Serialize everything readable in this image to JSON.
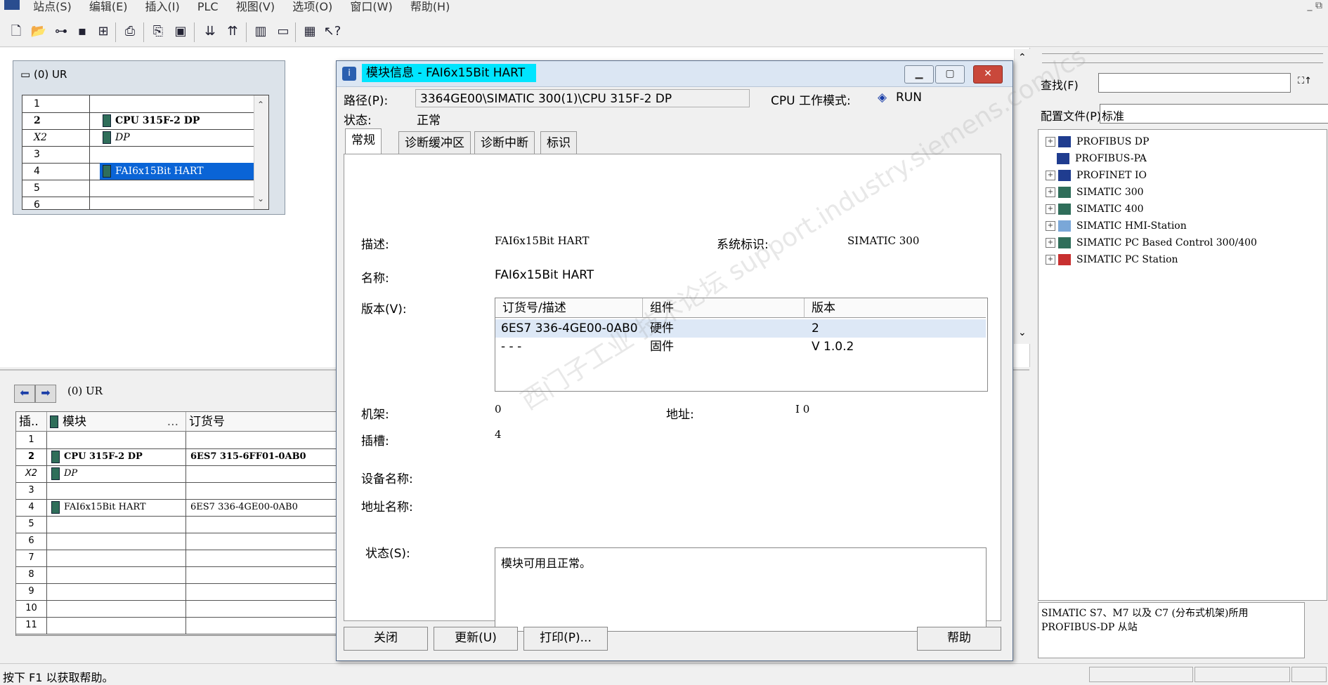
{
  "menu": [
    "站点(S)",
    "编辑(E)",
    "插入(I)",
    "PLC",
    "视图(V)",
    "选项(O)",
    "窗口(W)",
    "帮助(H)"
  ],
  "window_controls": "_ ⧉",
  "rack": {
    "title": "(0) UR",
    "rows": [
      {
        "slot": "1",
        "module": ""
      },
      {
        "slot": "2",
        "module": "CPU 315F-2 DP"
      },
      {
        "slot": "X2",
        "module": "DP"
      },
      {
        "slot": "3",
        "module": ""
      },
      {
        "slot": "4",
        "module": "FAI6x15Bit HART"
      },
      {
        "slot": "5",
        "module": ""
      },
      {
        "slot": "6",
        "module": ""
      }
    ]
  },
  "lower": {
    "title": "(0)    UR",
    "col_slot": "插..",
    "col_module": "模块",
    "col_module_more": "...",
    "col_order": "订货号",
    "rows": [
      {
        "slot": "1",
        "module": "",
        "order": ""
      },
      {
        "slot": "2",
        "module": "CPU 315F-2 DP",
        "order": "6ES7 315-6FF01-0AB0"
      },
      {
        "slot": "X2",
        "module": "DP",
        "order": ""
      },
      {
        "slot": "3",
        "module": "",
        "order": ""
      },
      {
        "slot": "4",
        "module": "FAI6x15Bit HART",
        "order": "6ES7 336-4GE00-0AB0"
      },
      {
        "slot": "5",
        "module": "",
        "order": ""
      },
      {
        "slot": "6",
        "module": "",
        "order": ""
      },
      {
        "slot": "7",
        "module": "",
        "order": ""
      },
      {
        "slot": "8",
        "module": "",
        "order": ""
      },
      {
        "slot": "9",
        "module": "",
        "order": ""
      },
      {
        "slot": "10",
        "module": "",
        "order": ""
      },
      {
        "slot": "11",
        "module": "",
        "order": ""
      }
    ]
  },
  "status_bar": "按下 F1 以获取帮助。",
  "catalog": {
    "find_label": "查找(F)",
    "profile_label": "配置文件(P)",
    "profile_value": "标准",
    "tree": [
      "PROFIBUS DP",
      "PROFIBUS-PA",
      "PROFINET IO",
      "SIMATIC 300",
      "SIMATIC 400",
      "SIMATIC HMI-Station",
      "SIMATIC PC Based Control 300/400",
      "SIMATIC PC Station"
    ],
    "description": "SIMATIC S7、M7 以及 C7 (分布式机架)所用 PROFIBUS-DP 从站"
  },
  "dialog": {
    "title": "模块信息 - FAI6x15Bit HART",
    "path_label": "路径(P):",
    "path_value": "3364GE00\\SIMATIC 300(1)\\CPU 315F-2 DP",
    "cpu_mode_label": "CPU 工作模式:",
    "cpu_mode_value": "RUN",
    "state_label": "状态:",
    "state_value": "正常",
    "tabs": [
      "常规",
      "诊断缓冲区",
      "诊断中断",
      "标识"
    ],
    "desc_label": "描述:",
    "desc_value": "FAI6x15Bit HART",
    "sysid_label": "系统标识:",
    "sysid_value": "SIMATIC 300",
    "name_label": "名称:",
    "name_value": "FAI6x15Bit HART",
    "version_label": "版本(V):",
    "version_headers": [
      "订货号/描述",
      "组件",
      "版本"
    ],
    "version_rows": [
      {
        "order": "6ES7 336-4GE00-0AB0",
        "component": "硬件",
        "version": "2"
      },
      {
        "order": "- - -",
        "component": "固件",
        "version": "V 1.0.2"
      }
    ],
    "rack_label": "机架:",
    "rack_value": "0",
    "address_label": "地址:",
    "address_value": "I 0",
    "slot_label": "插槽:",
    "slot_value": "4",
    "device_name_label": "设备名称:",
    "address_name_label": "地址名称:",
    "status_label": "状态(S):",
    "status_text": "模块可用且正常。",
    "buttons": {
      "close": "关闭",
      "update": "更新(U)",
      "print": "打印(P)...",
      "help": "帮助"
    }
  },
  "watermark": "西门子工业 技术论坛 support.industry.siemens.com/cs",
  "colors": {
    "selection": "#0a64d6",
    "title_highlight": "#00e5ff",
    "close_button": "#c9483b"
  }
}
